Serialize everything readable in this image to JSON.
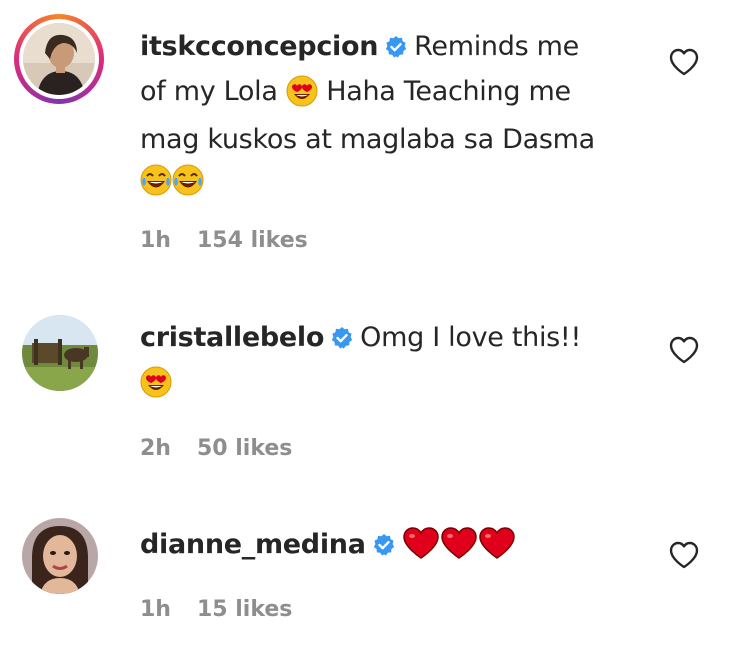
{
  "comments": [
    {
      "username": "itskcconcepcion",
      "text_1": "Reminds me",
      "text_2": "of my Lola",
      "text_3": "Haha Teaching me",
      "text_4": "mag kuskos at maglaba sa Dasma",
      "time": "1h",
      "likes": "154 likes",
      "avatar_icon": "profile-photo-woman"
    },
    {
      "username": "cristallebelo",
      "text_1": "Omg I love this!!",
      "time": "2h",
      "likes": "50 likes",
      "avatar_icon": "profile-photo-field"
    },
    {
      "username": "dianne_medina",
      "time": "1h",
      "likes": "15 likes",
      "avatar_icon": "profile-photo-woman-portrait"
    }
  ],
  "colors": {
    "verified": "#3897f0",
    "meta": "#8e8e8e",
    "text": "#262626",
    "heart_emoji": "#e0001b"
  }
}
